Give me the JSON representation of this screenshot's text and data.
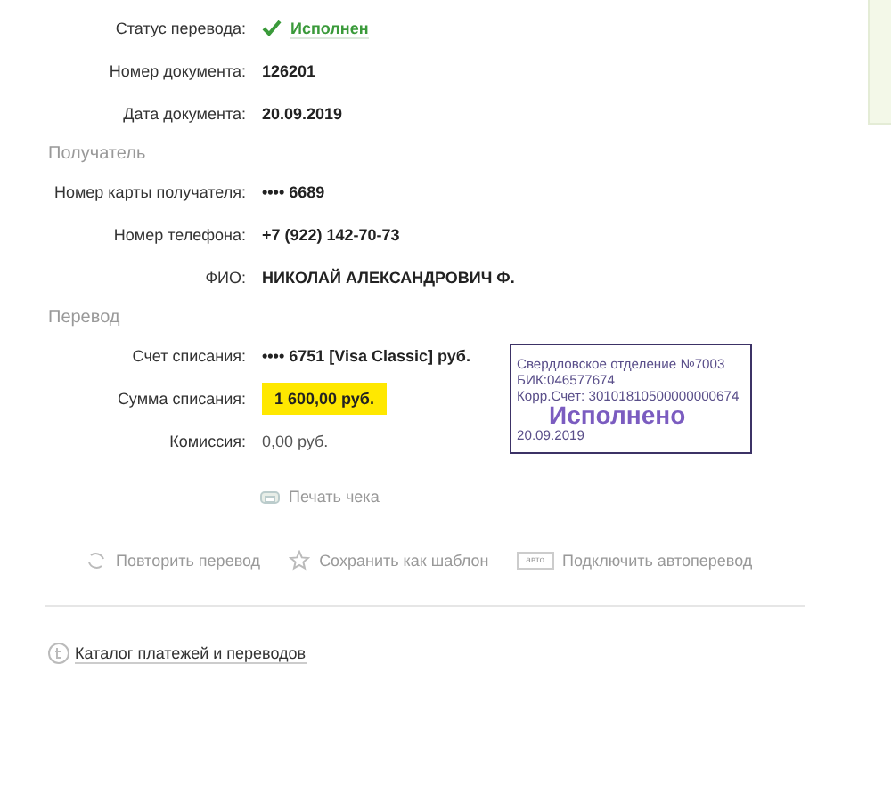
{
  "details": [
    {
      "label": "Статус перевода:",
      "value": "Исполнен",
      "kind": "status"
    },
    {
      "label": "Номер документа:",
      "value": "126201",
      "kind": "plain"
    },
    {
      "label": "Дата документа:",
      "value": "20.09.2019",
      "kind": "plain"
    }
  ],
  "recipient": {
    "title": "Получатель",
    "rows": [
      {
        "label": "Номер карты получателя:",
        "value": "•••• 6689",
        "kind": "plain"
      },
      {
        "label": "Номер телефона:",
        "value": "+7 (922) 142-70-73",
        "kind": "plain"
      },
      {
        "label": "ФИО:",
        "value": "НИКОЛАЙ АЛЕКСАНДРОВИЧ Ф.",
        "kind": "plain"
      }
    ]
  },
  "transfer": {
    "title": "Перевод",
    "rows": [
      {
        "label": "Счет списания:",
        "value": "•••• 6751  [Visa Classic]  руб.",
        "kind": "plain"
      },
      {
        "label": "Сумма списания:",
        "value": "1 600,00  руб.",
        "kind": "highlight"
      },
      {
        "label": "Комиссия:",
        "value": "0,00 руб.",
        "kind": "light"
      }
    ]
  },
  "stamp": {
    "lines": [
      "Свердловское отделение №7003",
      "БИК:046577674",
      "Корр.Счет: 30101810500000000674"
    ],
    "status": "Исполнено",
    "date": "20.09.2019"
  },
  "print_link": "Печать чека",
  "actions": [
    {
      "kind": "repeat",
      "label": "Повторить перевод"
    },
    {
      "kind": "template",
      "label": "Сохранить как шаблон"
    },
    {
      "kind": "auto",
      "badge": "авто",
      "label": "Подключить автоперевод"
    }
  ],
  "catalog_link": "Каталог платежей и переводов"
}
